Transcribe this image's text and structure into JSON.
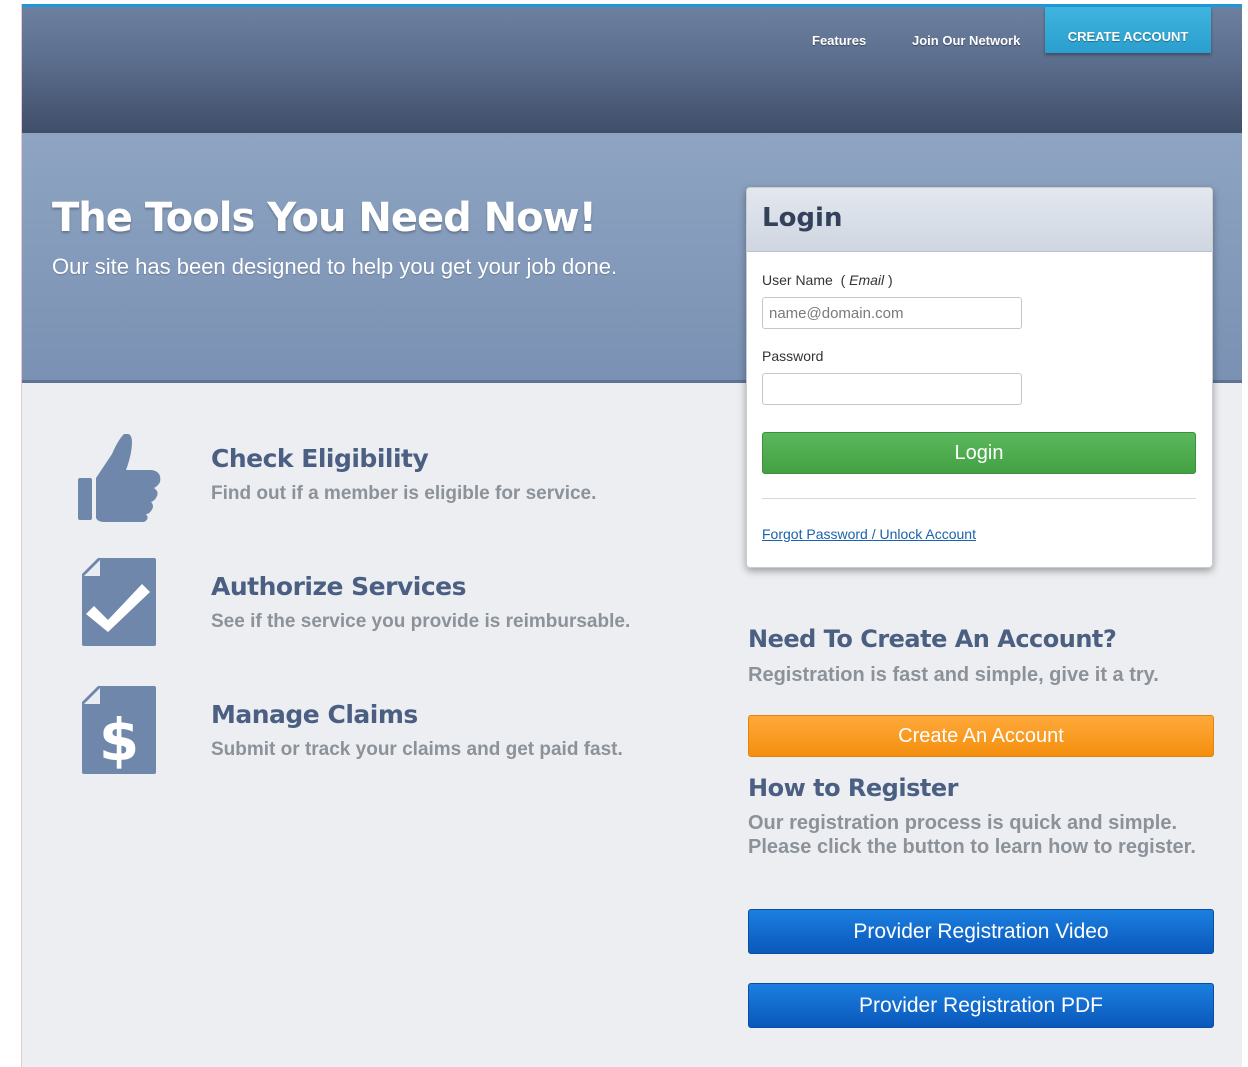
{
  "nav": {
    "features": "Features",
    "join_network": "Join Our Network",
    "create_account": "CREATE ACCOUNT"
  },
  "hero": {
    "title": "The Tools You Need Now!",
    "subtitle": "Our site has been designed to help you get your job done."
  },
  "features": [
    {
      "icon": "thumbs-up-icon",
      "title": "Check Eligibility",
      "description": "Find out if a member is eligible for service."
    },
    {
      "icon": "checklist-icon",
      "title": "Authorize Services",
      "description": "See if the service you provide is reimbursable."
    },
    {
      "icon": "dollar-document-icon",
      "title": "Manage Claims",
      "description": "Submit or track your claims and get paid fast."
    }
  ],
  "login": {
    "title": "Login",
    "username_label": "User Name",
    "username_hint": "Email",
    "username_placeholder": "name@domain.com",
    "username_value": "",
    "password_label": "Password",
    "password_value": "",
    "button": "Login",
    "forgot_link": "Forgot Password / Unlock Account"
  },
  "create_account": {
    "title": "Need To Create An Account?",
    "text": "Registration is fast and simple, give it a try.",
    "button": "Create An Account"
  },
  "how_to_register": {
    "title": "How to Register",
    "text": "Our registration process is quick and simple. Please click the button to learn how to register.",
    "video_button": "Provider Registration Video",
    "pdf_button": "Provider Registration PDF"
  },
  "colors": {
    "header_accent": "#1d9ad6",
    "heading_blue": "#4a5f82",
    "login_green": "#4cae4c",
    "create_orange": "#f7991c",
    "register_blue": "#1069c9"
  }
}
